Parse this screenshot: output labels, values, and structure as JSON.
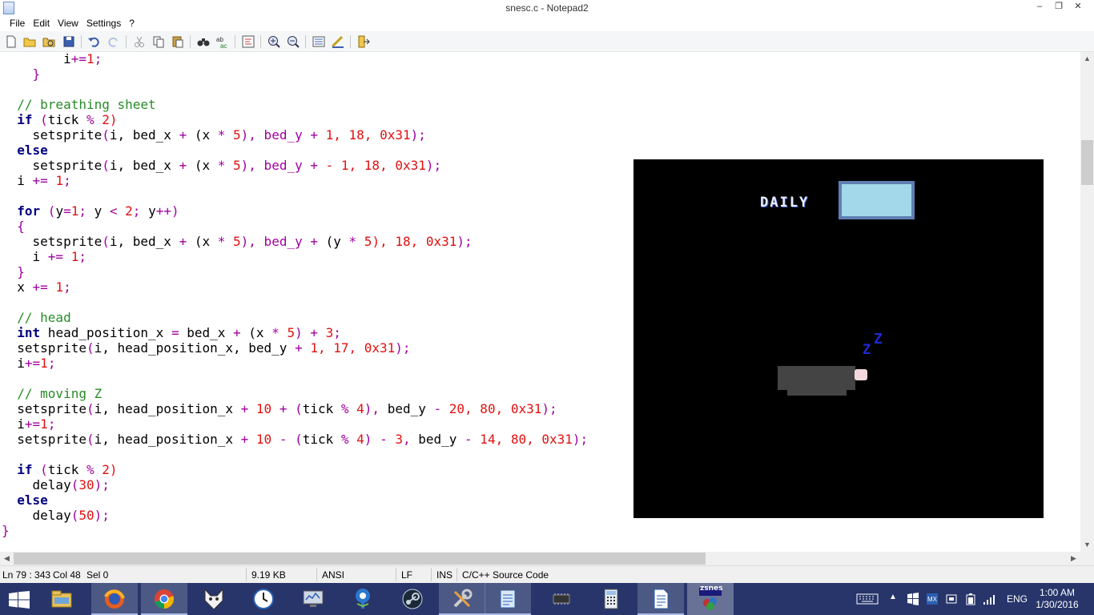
{
  "window": {
    "title": "snesc.c - Notepad2",
    "controls": {
      "minimize": "–",
      "restore": "❐",
      "close": "✕"
    }
  },
  "menu": [
    "File",
    "Edit",
    "View",
    "Settings",
    "?"
  ],
  "code_lines": [
    [
      [
        "        ",
        "id"
      ],
      [
        "i",
        "id"
      ],
      [
        "+=",
        "op"
      ],
      [
        "1",
        "num"
      ],
      [
        ";",
        "op"
      ]
    ],
    [
      [
        "    ",
        "id"
      ],
      [
        "}",
        "op"
      ]
    ],
    [
      [
        "",
        "id"
      ]
    ],
    [
      [
        "  ",
        "id"
      ],
      [
        "// breathing sheet",
        "cm"
      ]
    ],
    [
      [
        "  ",
        "id"
      ],
      [
        "if",
        "kw"
      ],
      [
        " (",
        "op"
      ],
      [
        "tick ",
        "id"
      ],
      [
        "%",
        "op"
      ],
      [
        " 2)",
        "num"
      ]
    ],
    [
      [
        "    ",
        "id"
      ],
      [
        "setsprite",
        "id"
      ],
      [
        "(",
        "op"
      ],
      [
        "i, bed_x ",
        "id"
      ],
      [
        "+",
        "op"
      ],
      [
        " (x ",
        "id"
      ],
      [
        "*",
        "op"
      ],
      [
        " 5",
        "num"
      ],
      [
        "), bed_y ",
        "op"
      ],
      [
        "+",
        "op"
      ],
      [
        " 1, 18, 0x31",
        "num"
      ],
      [
        ");",
        "op"
      ]
    ],
    [
      [
        "  ",
        "id"
      ],
      [
        "else",
        "kw"
      ]
    ],
    [
      [
        "    ",
        "id"
      ],
      [
        "setsprite",
        "id"
      ],
      [
        "(",
        "op"
      ],
      [
        "i, bed_x ",
        "id"
      ],
      [
        "+",
        "op"
      ],
      [
        " (x ",
        "id"
      ],
      [
        "*",
        "op"
      ],
      [
        " 5",
        "num"
      ],
      [
        "), bed_y ",
        "op"
      ],
      [
        "+",
        "op"
      ],
      [
        " - 1, 18, 0x31",
        "num"
      ],
      [
        ");",
        "op"
      ]
    ],
    [
      [
        "  ",
        "id"
      ],
      [
        "i ",
        "id"
      ],
      [
        "+=",
        "op"
      ],
      [
        " 1",
        "num"
      ],
      [
        ";",
        "op"
      ]
    ],
    [
      [
        "",
        "id"
      ]
    ],
    [
      [
        "  ",
        "id"
      ],
      [
        "for",
        "kw"
      ],
      [
        " (",
        "op"
      ],
      [
        "y",
        "id"
      ],
      [
        "=",
        "op"
      ],
      [
        "1",
        "num"
      ],
      [
        "; ",
        "op"
      ],
      [
        "y ",
        "id"
      ],
      [
        "<",
        "op"
      ],
      [
        " 2",
        "num"
      ],
      [
        "; ",
        "op"
      ],
      [
        "y",
        "id"
      ],
      [
        "++)",
        "op"
      ]
    ],
    [
      [
        "  ",
        "id"
      ],
      [
        "{",
        "op"
      ]
    ],
    [
      [
        "    ",
        "id"
      ],
      [
        "setsprite",
        "id"
      ],
      [
        "(",
        "op"
      ],
      [
        "i, bed_x ",
        "id"
      ],
      [
        "+",
        "op"
      ],
      [
        " (x ",
        "id"
      ],
      [
        "*",
        "op"
      ],
      [
        " 5",
        "num"
      ],
      [
        "), bed_y ",
        "op"
      ],
      [
        "+",
        "op"
      ],
      [
        " (y ",
        "id"
      ],
      [
        "*",
        "op"
      ],
      [
        " 5",
        "num"
      ],
      [
        "), 18, 0x31",
        "num"
      ],
      [
        ");",
        "op"
      ]
    ],
    [
      [
        "    ",
        "id"
      ],
      [
        "i ",
        "id"
      ],
      [
        "+=",
        "op"
      ],
      [
        " 1",
        "num"
      ],
      [
        ";",
        "op"
      ]
    ],
    [
      [
        "  ",
        "id"
      ],
      [
        "}",
        "op"
      ]
    ],
    [
      [
        "  ",
        "id"
      ],
      [
        "x ",
        "id"
      ],
      [
        "+=",
        "op"
      ],
      [
        " 1",
        "num"
      ],
      [
        ";",
        "op"
      ]
    ],
    [
      [
        "",
        "id"
      ]
    ],
    [
      [
        "  ",
        "id"
      ],
      [
        "// head",
        "cm"
      ]
    ],
    [
      [
        "  ",
        "id"
      ],
      [
        "int",
        "kw"
      ],
      [
        " head_position_x ",
        "id"
      ],
      [
        "=",
        "op"
      ],
      [
        " bed_x ",
        "id"
      ],
      [
        "+",
        "op"
      ],
      [
        " (x ",
        "id"
      ],
      [
        "*",
        "op"
      ],
      [
        " 5",
        "num"
      ],
      [
        ") ",
        "op"
      ],
      [
        "+",
        "op"
      ],
      [
        " 3",
        "num"
      ],
      [
        ";",
        "op"
      ]
    ],
    [
      [
        "  ",
        "id"
      ],
      [
        "setsprite",
        "id"
      ],
      [
        "(",
        "op"
      ],
      [
        "i, head_position_x, bed_y ",
        "id"
      ],
      [
        "+",
        "op"
      ],
      [
        " 1, 17, 0x31",
        "num"
      ],
      [
        ");",
        "op"
      ]
    ],
    [
      [
        "  ",
        "id"
      ],
      [
        "i",
        "id"
      ],
      [
        "+=",
        "op"
      ],
      [
        "1",
        "num"
      ],
      [
        ";",
        "op"
      ]
    ],
    [
      [
        "",
        "id"
      ]
    ],
    [
      [
        "  ",
        "id"
      ],
      [
        "// moving Z",
        "cm"
      ]
    ],
    [
      [
        "  ",
        "id"
      ],
      [
        "setsprite",
        "id"
      ],
      [
        "(",
        "op"
      ],
      [
        "i, head_position_x ",
        "id"
      ],
      [
        "+",
        "op"
      ],
      [
        " 10 ",
        "num"
      ],
      [
        "+",
        "op"
      ],
      [
        " (",
        "op"
      ],
      [
        "tick ",
        "id"
      ],
      [
        "%",
        "op"
      ],
      [
        " 4",
        "num"
      ],
      [
        "), ",
        "op"
      ],
      [
        "bed_y ",
        "id"
      ],
      [
        "-",
        "op"
      ],
      [
        " 20, 80, 0x31",
        "num"
      ],
      [
        ");",
        "op"
      ]
    ],
    [
      [
        "  ",
        "id"
      ],
      [
        "i",
        "id"
      ],
      [
        "+=",
        "op"
      ],
      [
        "1",
        "num"
      ],
      [
        ";",
        "op"
      ]
    ],
    [
      [
        "  ",
        "id"
      ],
      [
        "setsprite",
        "id"
      ],
      [
        "(",
        "op"
      ],
      [
        "i, head_position_x ",
        "id"
      ],
      [
        "+",
        "op"
      ],
      [
        " 10 ",
        "num"
      ],
      [
        "-",
        "op"
      ],
      [
        " (",
        "op"
      ],
      [
        "tick ",
        "id"
      ],
      [
        "%",
        "op"
      ],
      [
        " 4",
        "num"
      ],
      [
        ") ",
        "op"
      ],
      [
        "-",
        "op"
      ],
      [
        " 3",
        "num"
      ],
      [
        ", ",
        "op"
      ],
      [
        "bed_y ",
        "id"
      ],
      [
        "-",
        "op"
      ],
      [
        " 14, 80, 0x31",
        "num"
      ],
      [
        ");",
        "op"
      ]
    ],
    [
      [
        "",
        "id"
      ]
    ],
    [
      [
        "  ",
        "id"
      ],
      [
        "if",
        "kw"
      ],
      [
        " (",
        "op"
      ],
      [
        "tick ",
        "id"
      ],
      [
        "%",
        "op"
      ],
      [
        " 2)",
        "num"
      ]
    ],
    [
      [
        "    ",
        "id"
      ],
      [
        "delay",
        "id"
      ],
      [
        "(",
        "op"
      ],
      [
        "30",
        "num"
      ],
      [
        ");",
        "op"
      ]
    ],
    [
      [
        "  ",
        "id"
      ],
      [
        "else",
        "kw"
      ]
    ],
    [
      [
        "    ",
        "id"
      ],
      [
        "delay",
        "id"
      ],
      [
        "(",
        "op"
      ],
      [
        "50",
        "num"
      ],
      [
        ");",
        "op"
      ]
    ],
    [
      [
        "",
        "id"
      ],
      [
        "}",
        "op"
      ]
    ]
  ],
  "emulator": {
    "label": "DAILY",
    "z_small": "Z",
    "z_big": "Z"
  },
  "status": {
    "position": "Ln 79 : 343",
    "column": "Col 48",
    "selection": "Sel 0",
    "size": "9.19 KB",
    "encoding": "ANSI",
    "line_endings": "LF",
    "mode": "INS",
    "lexer": "C/C++ Source Code"
  },
  "taskbar": {
    "apps": [
      "file-explorer",
      "firefox",
      "chrome",
      "filezilla",
      "clock-app",
      "monitor-app",
      "sourcetree",
      "steam",
      "tools-app",
      "notepad2",
      "chip-app",
      "calculator",
      "writer",
      "zsnes"
    ],
    "zsnes_label": "zsnes",
    "language": "ENG",
    "time": "1:00 AM",
    "date": "1/30/2016",
    "tray_arrow": "▲"
  },
  "colors": {
    "taskbar": "#27356b",
    "keyword": "#00007f",
    "comment": "#268c26",
    "operator": "#a0009e",
    "number": "#e01010"
  }
}
